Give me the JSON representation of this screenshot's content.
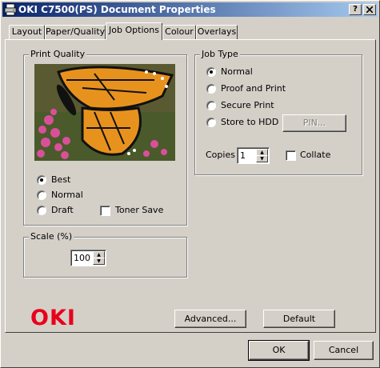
{
  "window": {
    "title": "OKI C7500(PS) Document Properties",
    "help_btn": "?",
    "close_btn": "X"
  },
  "tabs": [
    {
      "label": "Layout"
    },
    {
      "label": "Paper/Quality"
    },
    {
      "label": "Job Options"
    },
    {
      "label": "Colour"
    },
    {
      "label": "Overlays"
    }
  ],
  "print_quality": {
    "title": "Print Quality",
    "options": [
      "Best",
      "Normal",
      "Draft"
    ],
    "selected": "Best",
    "toner_save": "Toner Save"
  },
  "scale": {
    "title": "Scale (%)",
    "value": "100"
  },
  "job_type": {
    "title": "Job Type",
    "options": [
      "Normal",
      "Proof and Print",
      "Secure Print",
      "Store to HDD"
    ],
    "selected": "Normal",
    "pin_button": "PIN...",
    "copies_label": "Copies",
    "copies_value": "1",
    "collate": "Collate"
  },
  "buttons": {
    "advanced": "Advanced...",
    "default": "Default",
    "ok": "OK",
    "cancel": "Cancel"
  },
  "brand": {
    "logo": "OKI",
    "color": "#e8001c"
  }
}
